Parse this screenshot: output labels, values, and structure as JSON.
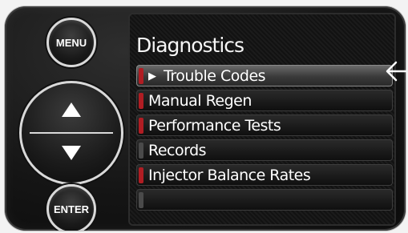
{
  "device": {
    "menu_button": "MENU",
    "enter_button": "ENTER",
    "nav": {
      "up_icon": "triangle-up-icon",
      "down_icon": "triangle-down-icon"
    }
  },
  "screen": {
    "title": "Diagnostics",
    "items": [
      {
        "label": "Trouble Codes",
        "selected": true,
        "marker_color": "#b01d23"
      },
      {
        "label": "Manual Regen",
        "selected": false,
        "marker_color": "#b01d23"
      },
      {
        "label": "Performance Tests",
        "selected": false,
        "marker_color": "#b01d23"
      },
      {
        "label": "Records",
        "selected": false,
        "marker_color": "#4a4a4a"
      },
      {
        "label": "Injector Balance Rates",
        "selected": false,
        "marker_color": "#b01d23"
      },
      {
        "label": "",
        "selected": false,
        "marker_color": "#4a4a4a"
      }
    ]
  },
  "pointer": {
    "icon": "left-arrow-icon"
  }
}
